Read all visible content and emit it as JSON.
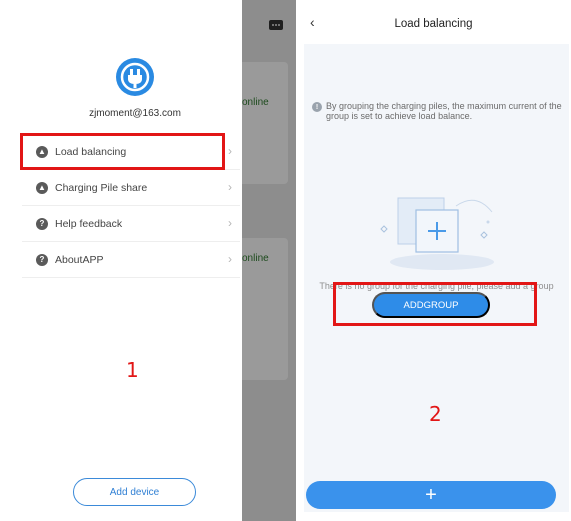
{
  "left": {
    "email": "zjmoment@163.com",
    "menu": [
      {
        "label": "Load balancing",
        "icon": "load-balance-icon"
      },
      {
        "label": "Charging Pile share",
        "icon": "share-icon"
      },
      {
        "label": "Help feedback",
        "icon": "help-icon"
      },
      {
        "label": "AboutAPP",
        "icon": "about-icon"
      }
    ],
    "step_label": "1",
    "add_device_label": "Add device",
    "background_status": [
      "online",
      "online"
    ]
  },
  "right": {
    "title": "Load balancing",
    "info_text": "By grouping the charging piles, the maximum current of the group is set to achieve load balance.",
    "empty_text": "There is no group for the charging pile, please add a group",
    "addgroup_label": "ADDGROUP",
    "step_label": "2",
    "bottom_add_glyph": "+"
  },
  "colors": {
    "primary_blue": "#2e8ce8",
    "highlight_red": "#e21616",
    "online_green": "#1c4a1c"
  }
}
